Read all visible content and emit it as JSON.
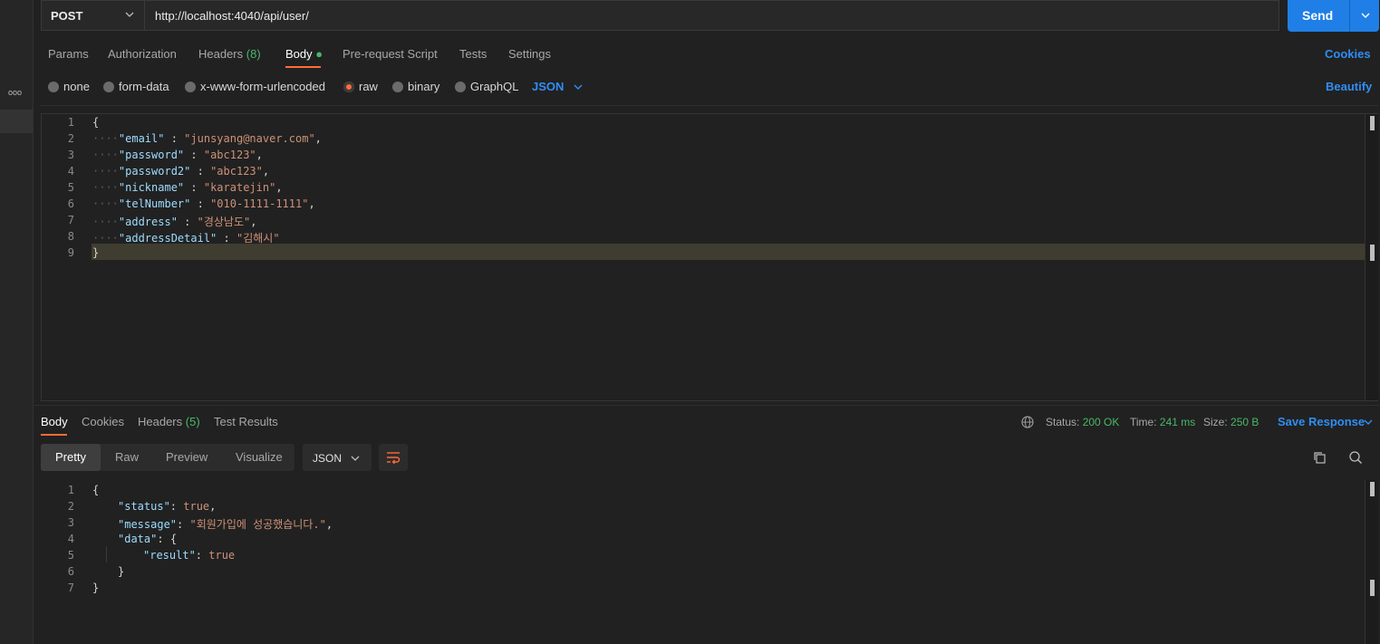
{
  "request": {
    "method": "POST",
    "url": "http://localhost:4040/api/user/",
    "send_label": "Send"
  },
  "sidebar": {
    "more_label": "ooo"
  },
  "req_tabs": [
    {
      "label": "Params"
    },
    {
      "label": "Authorization"
    },
    {
      "label": "Headers",
      "count": "(8)"
    },
    {
      "label": "Body"
    },
    {
      "label": "Pre-request Script"
    },
    {
      "label": "Tests"
    },
    {
      "label": "Settings"
    }
  ],
  "cookies_link": "Cookies",
  "body_types": [
    "none",
    "form-data",
    "x-www-form-urlencoded",
    "raw",
    "binary",
    "GraphQL"
  ],
  "body_format": "JSON",
  "beautify_label": "Beautify",
  "request_body_lines": [
    {
      "n": "1",
      "open": "{"
    },
    {
      "n": "2",
      "key": "\"email\"",
      "val": "\"junsyang@naver.com\"",
      "end": ","
    },
    {
      "n": "3",
      "key": "\"password\"",
      "val": "\"abc123\"",
      "end": ","
    },
    {
      "n": "4",
      "key": "\"password2\"",
      "val": "\"abc123\"",
      "end": ","
    },
    {
      "n": "5",
      "key": "\"nickname\"",
      "val": "\"karatejin\"",
      "end": ","
    },
    {
      "n": "6",
      "key": "\"telNumber\"",
      "val": "\"010-1111-1111\"",
      "end": ","
    },
    {
      "n": "7",
      "key": "\"address\"",
      "val": "\"경상남도\"",
      "end": ","
    },
    {
      "n": "8",
      "key": "\"addressDetail\"",
      "val": "\"김해시\"",
      "end": ""
    },
    {
      "n": "9",
      "open": "}"
    }
  ],
  "resp_tabs": [
    {
      "label": "Body"
    },
    {
      "label": "Cookies"
    },
    {
      "label": "Headers",
      "count": "(5)"
    },
    {
      "label": "Test Results"
    }
  ],
  "response_meta": {
    "status_label": "Status:",
    "status_value": "200 OK",
    "time_label": "Time:",
    "time_value": "241 ms",
    "size_label": "Size:",
    "size_value": "250 B",
    "save_label": "Save Response"
  },
  "view_modes": [
    "Pretty",
    "Raw",
    "Preview",
    "Visualize"
  ],
  "response_format": "JSON",
  "response_lines": [
    {
      "n": "1",
      "text": "{"
    },
    {
      "n": "2",
      "key": "\"status\"",
      "val": "true",
      "end": ","
    },
    {
      "n": "3",
      "key": "\"message\"",
      "val": "\"회원가입에 성공했습니다.\"",
      "end": ","
    },
    {
      "n": "4",
      "key": "\"data\"",
      "val": "{",
      "end": ""
    },
    {
      "n": "5",
      "key": "\"result\"",
      "val": "true",
      "end": ""
    },
    {
      "n": "6",
      "text": "}"
    },
    {
      "n": "7",
      "text": "}"
    }
  ],
  "colors": {
    "accent": "#ff6c37",
    "send": "#1f7fe6",
    "link": "#2f8ef5",
    "success": "#49b86a"
  }
}
